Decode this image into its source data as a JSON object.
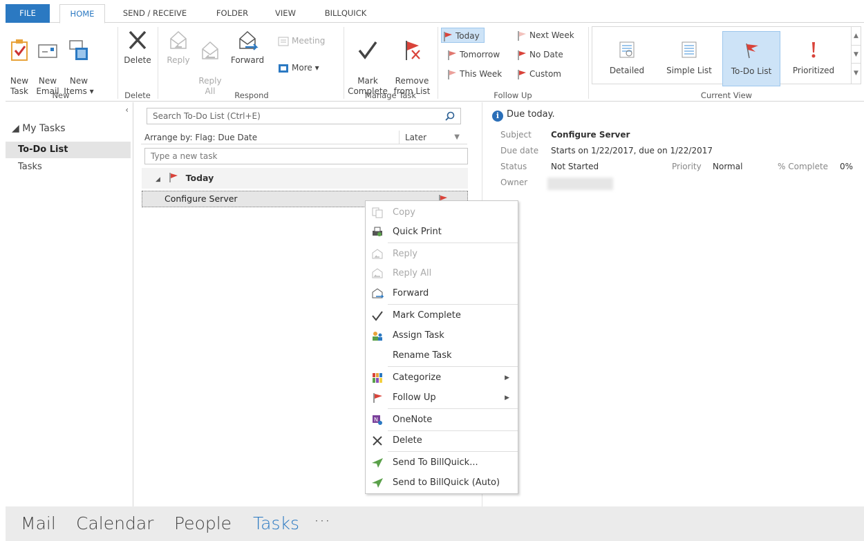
{
  "tabs": [
    {
      "label": "FILE"
    },
    {
      "label": "HOME"
    },
    {
      "label": "SEND / RECEIVE"
    },
    {
      "label": "FOLDER"
    },
    {
      "label": "VIEW"
    },
    {
      "label": "BILLQUICK"
    }
  ],
  "ribbon": {
    "new_group": {
      "label": "New",
      "new_task": "New\nTask",
      "new_email": "New\nEmail",
      "new_items": "New\nItems ▾"
    },
    "delete_group": {
      "label": "Delete",
      "delete": "Delete"
    },
    "respond_group": {
      "label": "Respond",
      "reply": "Reply",
      "reply_all": "Reply\nAll",
      "forward": "Forward",
      "meeting": "Meeting",
      "more": "More ▾"
    },
    "manage_group": {
      "label": "Manage Task",
      "mark_complete": "Mark\nComplete",
      "remove_from_list": "Remove\nfrom List"
    },
    "followup_group": {
      "label": "Follow Up",
      "today": "Today",
      "tomorrow": "Tomorrow",
      "this_week": "This Week",
      "next_week": "Next Week",
      "no_date": "No Date",
      "custom": "Custom"
    },
    "view_group": {
      "label": "Current View",
      "detailed": "Detailed",
      "simple_list": "Simple List",
      "todo_list": "To-Do List",
      "prioritized": "Prioritized"
    }
  },
  "nav": {
    "header": "◢ My Tasks",
    "items": [
      {
        "label": "To-Do List",
        "selected": true
      },
      {
        "label": "Tasks",
        "selected": false
      }
    ]
  },
  "list": {
    "search_placeholder": "Search To-Do List (Ctrl+E)",
    "arrange_by": "Arrange by: Flag: Due Date",
    "sort_order": "Later",
    "new_task_placeholder": "Type a new task",
    "group_header": "Today",
    "task_subject": "Configure Server"
  },
  "reading": {
    "info_text": "Due today.",
    "subject_label": "Subject",
    "subject_value": "Configure Server",
    "due_label": "Due date",
    "due_value": "Starts on 1/22/2017, due on 1/22/2017",
    "status_label": "Status",
    "status_value": "Not Started",
    "priority_label": "Priority",
    "priority_value": "Normal",
    "complete_label": "% Complete",
    "complete_value": "0%",
    "owner_label": "Owner"
  },
  "context_menu": [
    {
      "label": "Copy",
      "disabled": true
    },
    {
      "label": "Quick Print",
      "disabled": false
    },
    {
      "label": "Reply",
      "disabled": true
    },
    {
      "label": "Reply All",
      "disabled": true
    },
    {
      "label": "Forward",
      "disabled": false
    },
    {
      "label": "Mark Complete",
      "disabled": false
    },
    {
      "label": "Assign Task",
      "disabled": false
    },
    {
      "label": "Rename Task",
      "disabled": false
    },
    {
      "label": "Categorize",
      "disabled": false
    },
    {
      "label": "Follow Up",
      "disabled": false
    },
    {
      "label": "OneNote",
      "disabled": false
    },
    {
      "label": "Delete",
      "disabled": false
    },
    {
      "label": "Send To BillQuick...",
      "disabled": false
    },
    {
      "label": "Send to BillQuick (Auto)",
      "disabled": false
    }
  ],
  "bottom_nav": [
    {
      "label": "Mail"
    },
    {
      "label": "Calendar"
    },
    {
      "label": "People"
    },
    {
      "label": "Tasks"
    },
    {
      "label": "···"
    }
  ],
  "colors": {
    "accent": "#2b79c2",
    "flag": "#d9433a",
    "selection": "#cde3f7"
  }
}
